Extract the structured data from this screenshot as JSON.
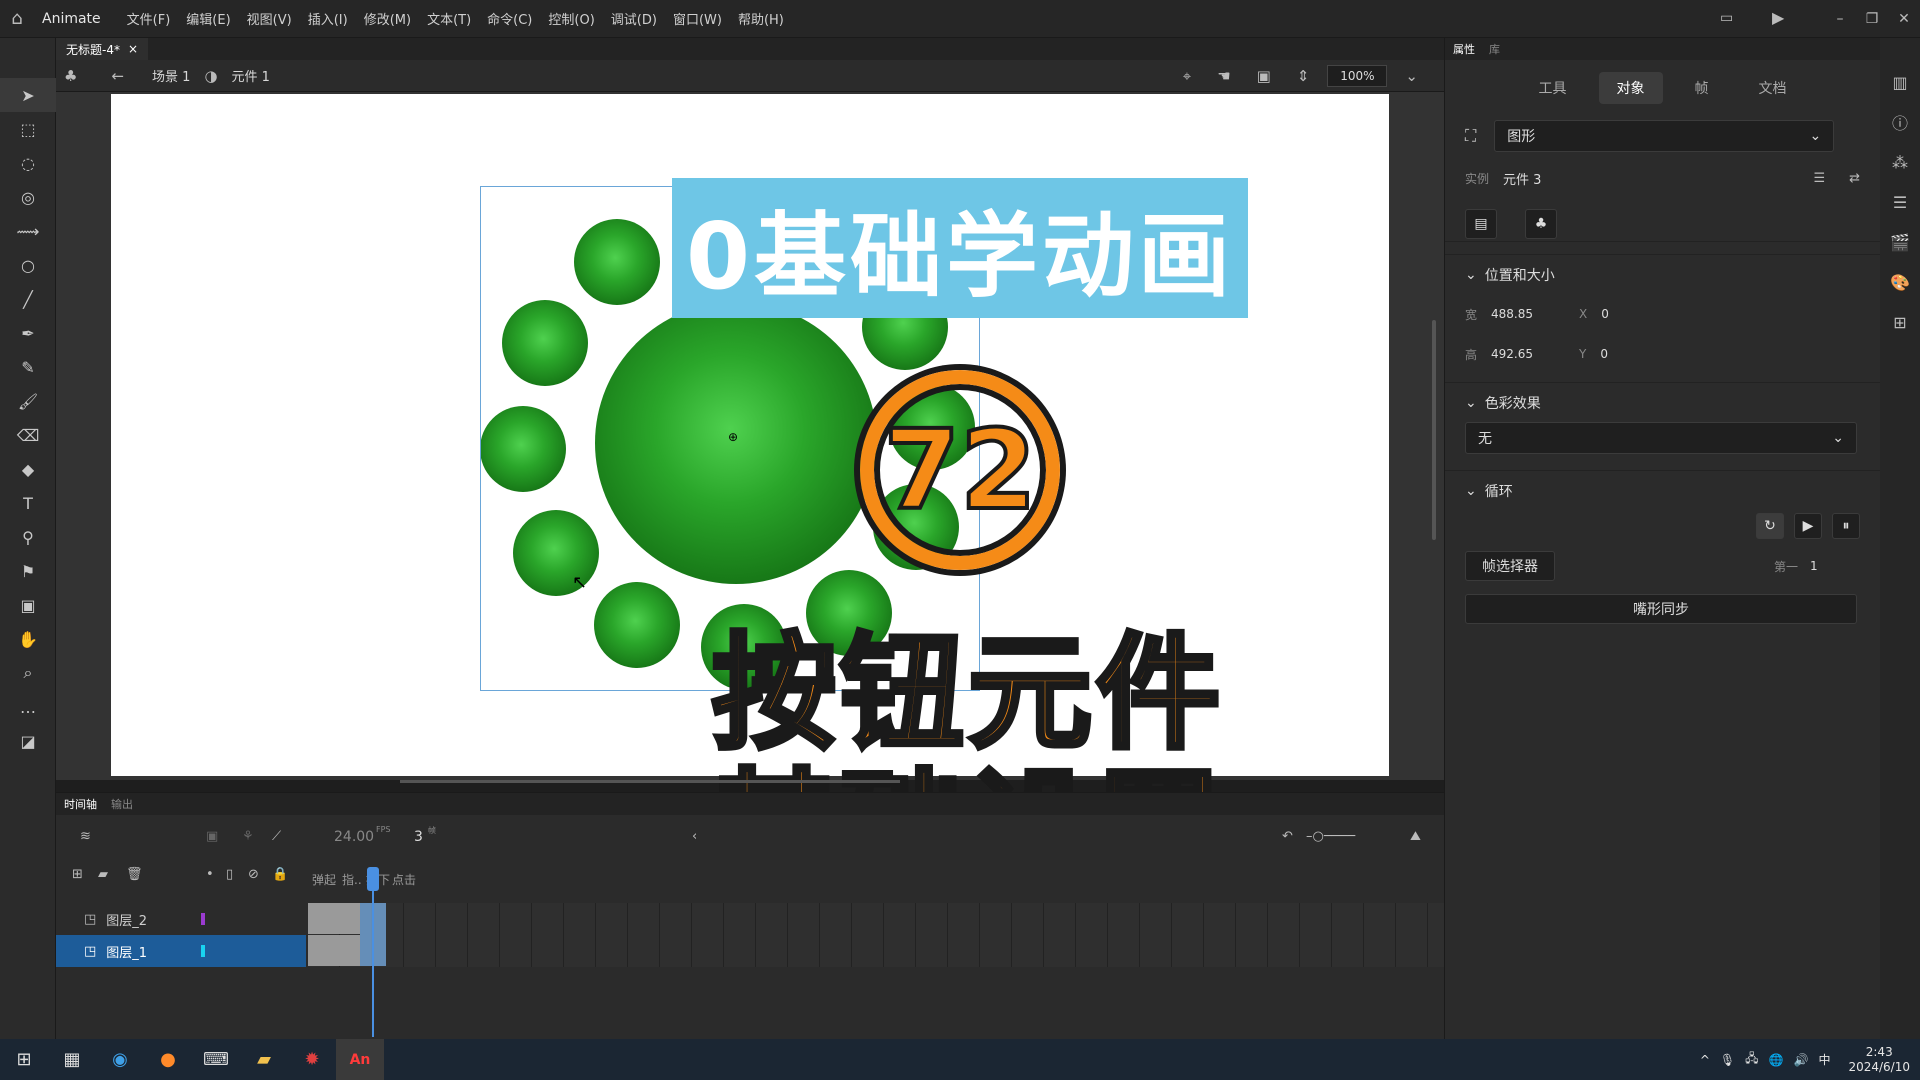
{
  "app": {
    "name": "Animate"
  },
  "menu": [
    "文件(F)",
    "编辑(E)",
    "视图(V)",
    "插入(I)",
    "修改(M)",
    "文本(T)",
    "命令(C)",
    "控制(O)",
    "调试(D)",
    "窗口(W)",
    "帮助(H)"
  ],
  "document": {
    "tab_title": "无标题-4*",
    "close": "×"
  },
  "editbar": {
    "scene": "场景 1",
    "symbol": "元件 1",
    "zoom": "100%"
  },
  "overlay": {
    "banner": "0基础学动画",
    "number": "72",
    "title_line1": "按钮元件",
    "title_line2": "基础设置"
  },
  "properties": {
    "head_tabs": [
      "属性",
      "库"
    ],
    "tabs": [
      "工具",
      "对象",
      "帧",
      "文档"
    ],
    "selected_tab": "对象",
    "type_dropdown": "图形",
    "instance_label": "实例",
    "instance_value": "元件 3",
    "section_pos": "位置和大小",
    "w_label": "宽",
    "w_value": "488.85",
    "h_label": "高",
    "h_value": "492.65",
    "x_label": "X",
    "x_value": "0",
    "y_label": "Y",
    "y_value": "0",
    "section_color": "色彩效果",
    "color_dropdown": "无",
    "section_loop": "循环",
    "frame_picker": "帧选择器",
    "first_label": "第一",
    "first_value": "1",
    "lip_sync": "嘴形同步"
  },
  "timeline": {
    "tabs": [
      "时间轴",
      "输出"
    ],
    "fps": "24.00",
    "fps_unit": "FPS",
    "frame": "3",
    "frame_unit": "帧",
    "frame_labels": [
      "弹起",
      "指..",
      "按下",
      "点击"
    ],
    "layers": [
      {
        "name": "图层_2",
        "color": "#9b3bd0",
        "selected": false
      },
      {
        "name": "图层_1",
        "color": "#19d3f0",
        "selected": true
      }
    ]
  },
  "taskbar": {
    "time": "2:43",
    "date": "2024/6/10",
    "ime": "中"
  }
}
